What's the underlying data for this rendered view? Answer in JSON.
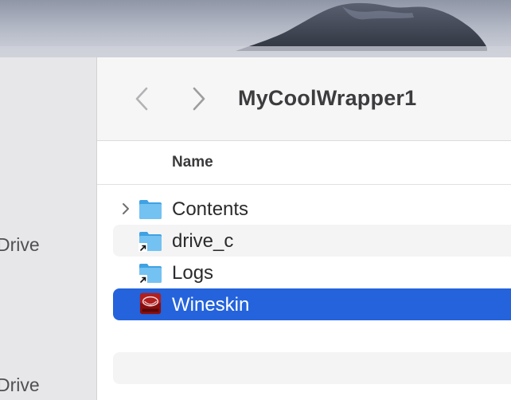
{
  "window": {
    "title": "MyCoolWrapper1"
  },
  "sidebar": {
    "items": [
      {
        "label": "Drive"
      },
      {
        "label": "Drive"
      }
    ]
  },
  "toolbar": {
    "back_icon": "chevron-left-icon",
    "forward_icon": "chevron-right-icon"
  },
  "list": {
    "column_header": "Name",
    "rows": [
      {
        "name": "Contents",
        "icon": "folder-icon",
        "expandable": true,
        "alias": false,
        "selected": false
      },
      {
        "name": "drive_c",
        "icon": "folder-alias-icon",
        "expandable": false,
        "alias": true,
        "selected": false
      },
      {
        "name": "Logs",
        "icon": "folder-alias-icon",
        "expandable": false,
        "alias": true,
        "selected": false
      },
      {
        "name": "Wineskin",
        "icon": "wineskin-app-icon",
        "expandable": false,
        "alias": false,
        "selected": true
      }
    ]
  },
  "colors": {
    "selection": "#2463db",
    "folder": "#5ab4ec",
    "sidebar_bg": "#e7e6e8"
  }
}
